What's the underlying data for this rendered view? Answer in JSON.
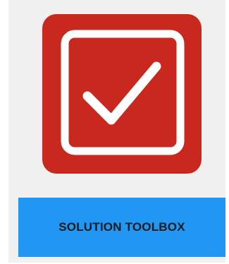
{
  "tile": {
    "icon": "checkbox-checked-icon",
    "button_label": "SOLUTION TOOLBOX",
    "colors": {
      "icon_background": "#c8281e",
      "icon_foreground": "#ffffff",
      "button_background": "#2196f3",
      "button_text": "#1a1a1a",
      "card_background": "#f0f0f0"
    }
  }
}
